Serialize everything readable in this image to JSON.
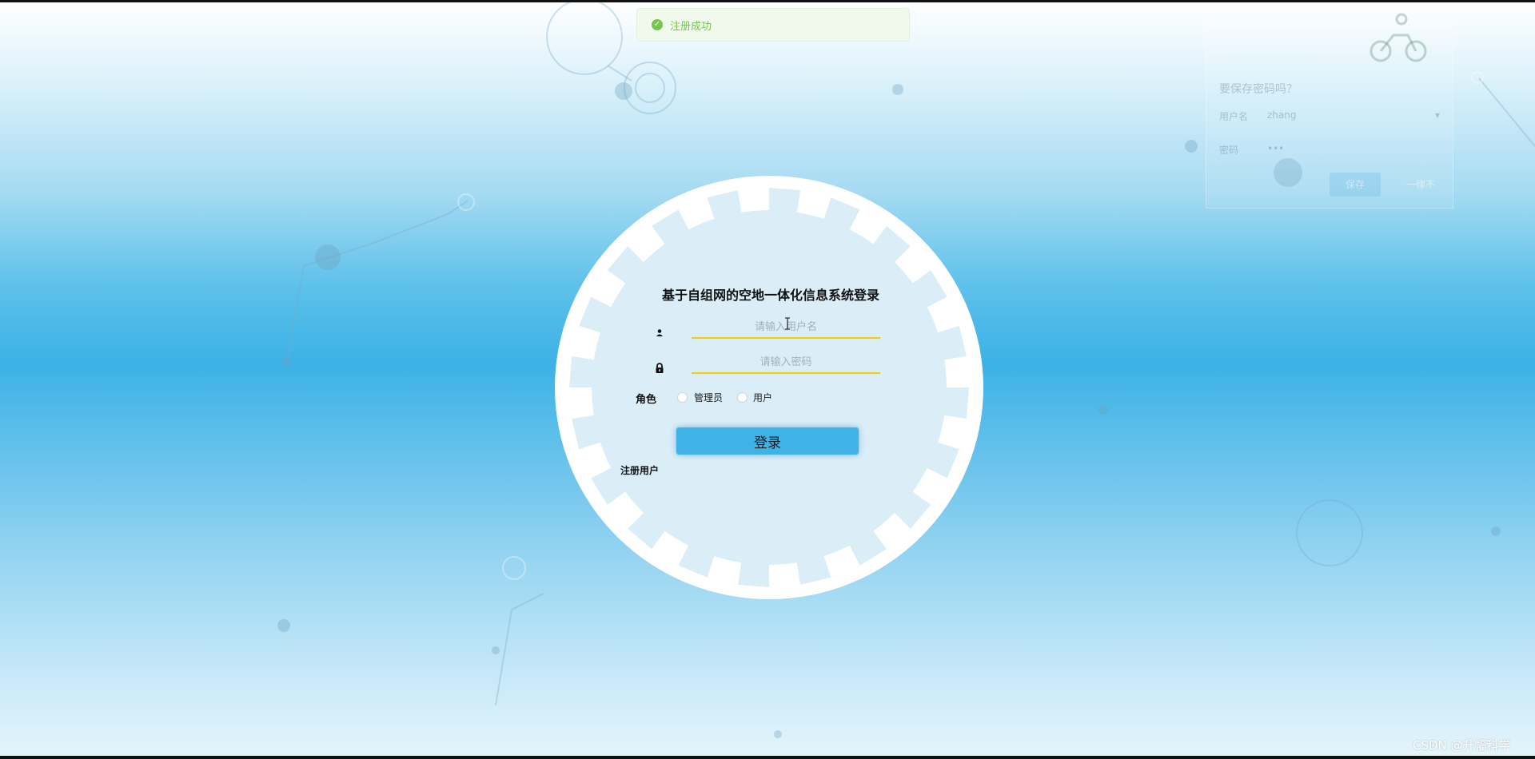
{
  "toast": {
    "message": "注册成功",
    "type": "success",
    "color": "#67c23a"
  },
  "ghost_dialog": {
    "title": "要保存密码吗？",
    "username_label": "用户名",
    "username_value": "zhang",
    "password_label": "密码",
    "password_value": "•••",
    "save_label": "保存",
    "cancel_label": "一律不"
  },
  "login": {
    "title": "基于自组网的空地一体化信息系统登录",
    "username_placeholder": "请输入用户名",
    "password_placeholder": "请输入密码",
    "role_label": "角色",
    "roles": [
      "管理员",
      "用户"
    ],
    "login_button": "登录",
    "register_link": "注册用户",
    "input_underline_color": "#f0d000",
    "button_color": "#3fb2e6"
  },
  "watermark": "CSDN @升幅科学",
  "icons": {
    "user": "user-icon",
    "lock": "lock-icon",
    "success": "check-circle-icon",
    "bicycle": "cyclist-icon"
  }
}
